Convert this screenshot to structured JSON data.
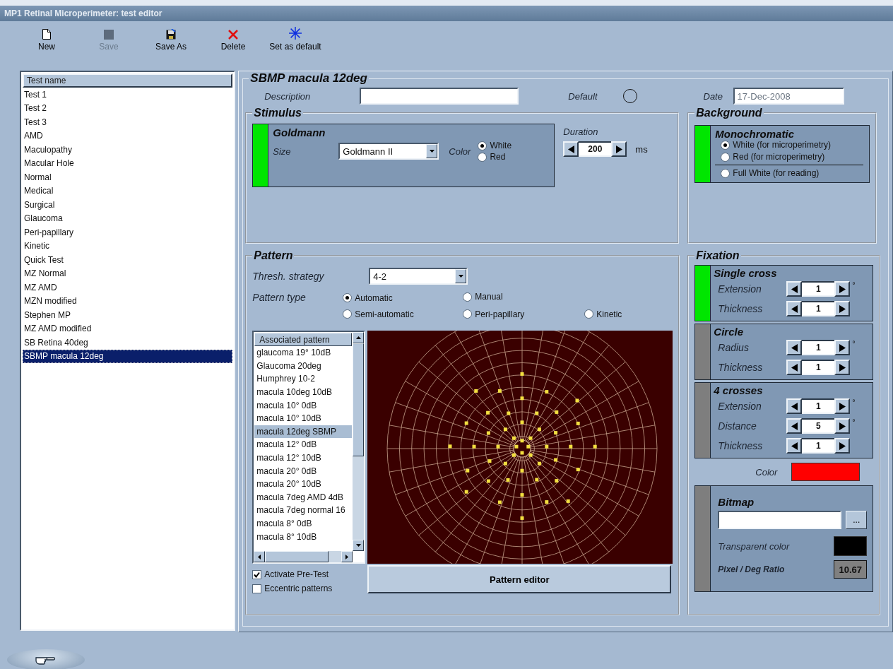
{
  "window": {
    "title": "MP1 Retinal Microperimeter: test editor"
  },
  "toolbar": [
    {
      "label": "New",
      "disabled": false
    },
    {
      "label": "Save",
      "disabled": true
    },
    {
      "label": "Save As",
      "disabled": false
    },
    {
      "label": "Delete",
      "disabled": false
    },
    {
      "label": "Set as default",
      "disabled": false
    }
  ],
  "test_list": {
    "header": "Test name",
    "items": [
      {
        "label": "Test 1",
        "selected": false
      },
      {
        "label": "Test 2",
        "selected": false
      },
      {
        "label": "Test 3",
        "selected": false
      },
      {
        "label": "AMD",
        "selected": false
      },
      {
        "label": "Maculopathy",
        "selected": false
      },
      {
        "label": "Macular Hole",
        "selected": false
      },
      {
        "label": "Normal",
        "selected": false
      },
      {
        "label": "Medical",
        "selected": false
      },
      {
        "label": "Surgical",
        "selected": false
      },
      {
        "label": "Glaucoma",
        "selected": false
      },
      {
        "label": "Peri-papillary",
        "selected": false
      },
      {
        "label": "Kinetic",
        "selected": false
      },
      {
        "label": "Quick Test",
        "selected": false
      },
      {
        "label": "MZ Normal",
        "selected": false
      },
      {
        "label": "MZ AMD",
        "selected": false
      },
      {
        "label": "MZN modified",
        "selected": false
      },
      {
        "label": "Stephen MP",
        "selected": false
      },
      {
        "label": "MZ AMD modified",
        "selected": false
      },
      {
        "label": "SB Retina 40deg",
        "selected": false
      },
      {
        "label": "SBMP macula 12deg",
        "selected": true
      }
    ]
  },
  "editor": {
    "title": "SBMP macula 12deg",
    "description": {
      "label": "Description"
    },
    "default": {
      "label": "Default",
      "checked": false
    },
    "date": {
      "label": "Date",
      "value": "17-Dec-2008"
    }
  },
  "stimulus": {
    "title": "Stimulus",
    "type": {
      "title": "Goldmann",
      "active": true
    },
    "size": {
      "label": "Size",
      "value": "Goldmann II"
    },
    "color": {
      "label": "Color",
      "options": [
        {
          "label": "White",
          "selected": true
        },
        {
          "label": "Red",
          "selected": false
        }
      ]
    },
    "duration": {
      "label": "Duration",
      "value": "200",
      "unit": "ms"
    }
  },
  "background": {
    "title": "Background",
    "mode": {
      "title": "Monochromatic",
      "active": true
    },
    "options": [
      {
        "label": "White (for microperimetry)",
        "selected": true
      },
      {
        "label": "Red (for microperimetry)",
        "selected": false
      },
      {
        "label": "Full White (for reading)",
        "selected": false
      }
    ]
  },
  "pattern": {
    "title": "Pattern",
    "strategy": {
      "label": "Thresh. strategy",
      "value": "4-2"
    },
    "pattern_type": {
      "label": "Pattern type",
      "options": [
        {
          "label": "Automatic",
          "selected": true
        },
        {
          "label": "Manual",
          "selected": false
        },
        {
          "label": "Semi-automatic",
          "selected": false
        },
        {
          "label": "Peri-papillary",
          "selected": false
        },
        {
          "label": "Kinetic",
          "selected": false
        }
      ]
    },
    "associated": {
      "header": "Associated pattern",
      "items": [
        {
          "label": "glaucoma 19° 10dB",
          "selected": false
        },
        {
          "label": "Glaucoma 20deg",
          "selected": false
        },
        {
          "label": "Humphrey 10-2",
          "selected": false
        },
        {
          "label": "macula 10deg 10dB",
          "selected": false
        },
        {
          "label": "macula 10° 0dB",
          "selected": false
        },
        {
          "label": "macula 10° 10dB",
          "selected": false
        },
        {
          "label": "macula 12deg SBMP",
          "selected": true
        },
        {
          "label": "macula 12° 0dB",
          "selected": false
        },
        {
          "label": "macula 12° 10dB",
          "selected": false
        },
        {
          "label": "macula 20° 0dB",
          "selected": false
        },
        {
          "label": "macula 20° 10dB",
          "selected": false
        },
        {
          "label": "macula 7deg AMD 4dB",
          "selected": false
        },
        {
          "label": "macula 7deg normal 16",
          "selected": false
        },
        {
          "label": "macula 8° 0dB",
          "selected": false
        },
        {
          "label": "macula 8° 10dB",
          "selected": false
        }
      ]
    },
    "checkboxes": [
      {
        "label": "Activate Pre-Test",
        "checked": true
      },
      {
        "label": "Eccentric patterns",
        "checked": false
      }
    ],
    "editor_button": "Pattern editor"
  },
  "fixation": {
    "title": "Fixation",
    "targets": [
      {
        "title": "Single cross",
        "active": true,
        "params": [
          {
            "label": "Extension",
            "value": "1",
            "unit": "°"
          },
          {
            "label": "Thickness",
            "value": "1"
          }
        ]
      },
      {
        "title": "Circle",
        "active": false,
        "params": [
          {
            "label": "Radius",
            "value": "1",
            "unit": "°"
          },
          {
            "label": "Thickness",
            "value": "1"
          }
        ]
      },
      {
        "title": "4 crosses",
        "active": false,
        "params": [
          {
            "label": "Extension",
            "value": "1",
            "unit": "°"
          },
          {
            "label": "Distance",
            "value": "5",
            "unit": "°"
          },
          {
            "label": "Thickness",
            "value": "1"
          }
        ]
      }
    ],
    "color": {
      "label": "Color",
      "color": "#ff0000"
    },
    "bitmap": {
      "title": "Bitmap",
      "active": false,
      "browse": "...",
      "transparent": {
        "label": "Transparent color",
        "color": "#000000"
      },
      "ratio_label": "Pixel / Deg Ratio",
      "ratio": "10.67"
    }
  }
}
